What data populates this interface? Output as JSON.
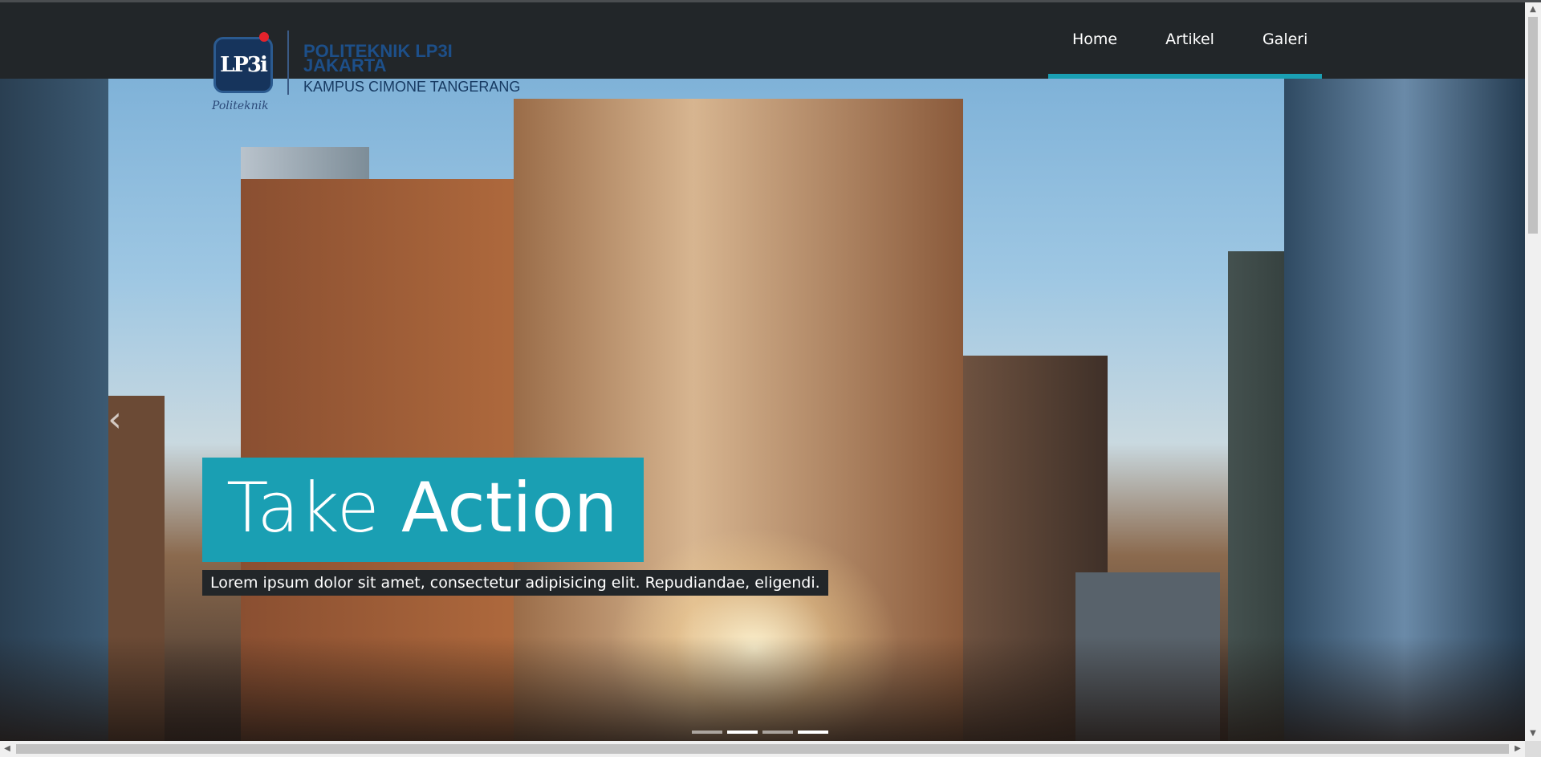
{
  "brand": {
    "logo_mark": "LP3i",
    "logo_script": "Politeknik",
    "name_line1": "POLITEKNIK LP3I",
    "name_line2": "JAKARTA",
    "campus": "KAMPUS CIMONE TANGERANG"
  },
  "nav": {
    "items": [
      {
        "label": "Home"
      },
      {
        "label": "Artikel"
      },
      {
        "label": "Galeri"
      }
    ],
    "active": "Home"
  },
  "hero": {
    "title_light": "Take",
    "title_bold": "Action",
    "subtitle": "Lorem ipsum dolor sit amet, consectetur adipisicing elit. Repudiandae, eligendi.",
    "prev_icon": "‹",
    "slide_count": 4,
    "active_slide": 2
  },
  "colors": {
    "accent": "#1a9fb3",
    "navbar": "#222629",
    "brand_blue": "#1d4f89",
    "logo_red": "#e3232c"
  },
  "icons": {
    "carousel_prev": "chevron-left-icon",
    "scroll_up": "arrow-up-icon",
    "scroll_down": "arrow-down-icon",
    "scroll_left": "arrow-left-icon",
    "scroll_right": "arrow-right-icon"
  }
}
